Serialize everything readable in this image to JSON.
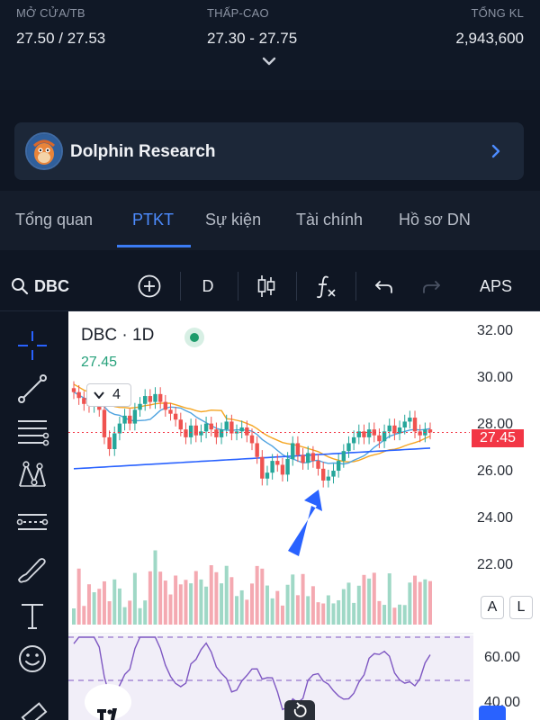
{
  "stats": {
    "open_avg": {
      "label": "MỞ CỬA/TB",
      "value": "27.50 / 27.53"
    },
    "low_high": {
      "label": "THẤP-CAO",
      "value": "27.30 - 27.75"
    },
    "volume": {
      "label": "TỔNG KL",
      "value": "2,943,600"
    }
  },
  "banner": {
    "title": "Dolphin Research"
  },
  "tabs": [
    {
      "label": "Tổng quan"
    },
    {
      "label": "PTKT"
    },
    {
      "label": "Sự kiện"
    },
    {
      "label": "Tài chính"
    },
    {
      "label": "Hồ sơ DN"
    }
  ],
  "active_tab": "PTKT",
  "toolbar": {
    "symbol": "DBC",
    "interval": "D",
    "broker": "APS"
  },
  "chart": {
    "symbol_title": "DBC · 1D",
    "last_price": "27.45",
    "ma_count": "4",
    "price_tag": "27.45",
    "y_labels": [
      "32.00",
      "30.00",
      "28.00",
      "26.00",
      "24.00",
      "22.00"
    ],
    "scale_buttons": [
      "A",
      "L"
    ],
    "rsi_labels": [
      "60.00",
      "40.00"
    ]
  },
  "chart_data": {
    "type": "candlestick",
    "symbol": "DBC",
    "interval": "1D",
    "ylim": [
      20.6,
      32.6
    ],
    "closes": [
      29.5,
      29.2,
      28.9,
      28.8,
      29.1,
      28.6,
      27.2,
      26.6,
      27.4,
      27.9,
      28.3,
      27.9,
      28.6,
      28.9,
      29.3,
      29.0,
      29.4,
      29.0,
      28.6,
      28.4,
      28.1,
      27.6,
      27.2,
      27.8,
      27.3,
      27.5,
      27.9,
      27.6,
      27.2,
      27.6,
      28.0,
      27.4,
      27.5,
      27.7,
      27.3,
      26.9,
      26.2,
      25.1,
      25.4,
      26.0,
      25.8,
      25.3,
      26.1,
      26.9,
      26.3,
      25.9,
      26.4,
      26.0,
      25.6,
      25.0,
      25.2,
      25.5,
      26.0,
      26.5,
      26.9,
      27.2,
      27.5,
      27.2,
      27.6,
      27.3,
      27.0,
      27.5,
      27.8,
      27.4,
      27.7,
      28.0,
      28.2,
      27.5,
      27.3,
      27.6,
      27.45
    ],
    "ma_periods_shown": 4,
    "last": 27.45
  }
}
